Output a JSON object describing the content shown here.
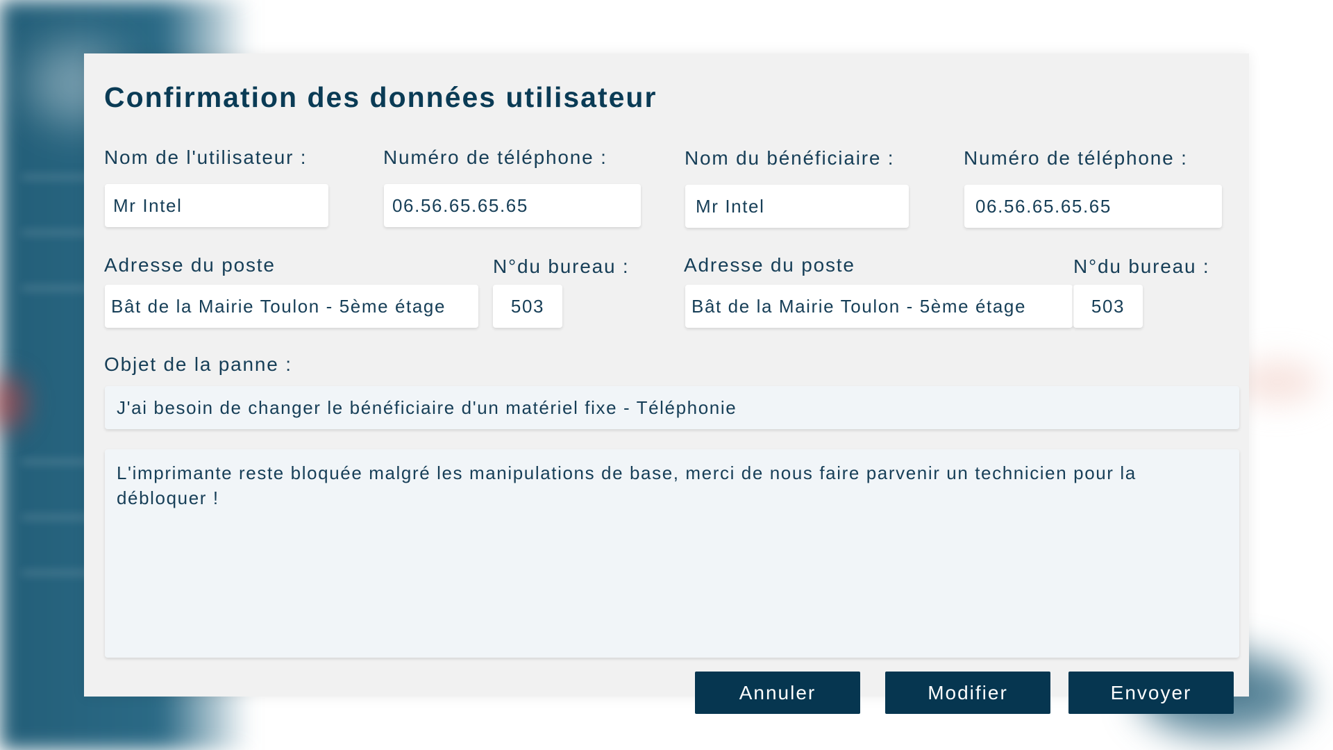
{
  "dialog": {
    "title": "Confirmation des données utilisateur",
    "user": {
      "name_label": "Nom de l'utilisateur :",
      "name_value": "Mr Intel",
      "phone_label": "Numéro de téléphone :",
      "phone_value": "06.56.65.65.65",
      "address_label": "Adresse du poste",
      "address_value": "Bât de la Mairie Toulon - 5ème étage",
      "office_label": "N°du bureau :",
      "office_value": "503"
    },
    "beneficiary": {
      "name_label": "Nom du bénéficiaire :",
      "name_value": "Mr Intel",
      "phone_label": "Numéro de téléphone :",
      "phone_value": "06.56.65.65.65",
      "address_label": "Adresse du poste",
      "address_value": "Bât de la Mairie Toulon - 5ème étage",
      "office_label": "N°du bureau :",
      "office_value": "503"
    },
    "issue": {
      "subject_label": "Objet de la panne :",
      "subject_value": "J'ai besoin de changer le bénéficiaire d'un matériel fixe - Téléphonie",
      "description": "L'imprimante reste bloquée malgré les manipulations de base, merci de nous faire parvenir un technicien pour la débloquer !"
    },
    "actions": {
      "cancel_label": "Annuler",
      "edit_label": "Modifier",
      "send_label": "Envoyer"
    }
  },
  "colors": {
    "primary": "#063650",
    "title": "#0a3b55",
    "text": "#163e57",
    "modal_background": "#f1f1f1",
    "input_background": "#ffffff",
    "readonly_background": "#f1f5f8"
  }
}
